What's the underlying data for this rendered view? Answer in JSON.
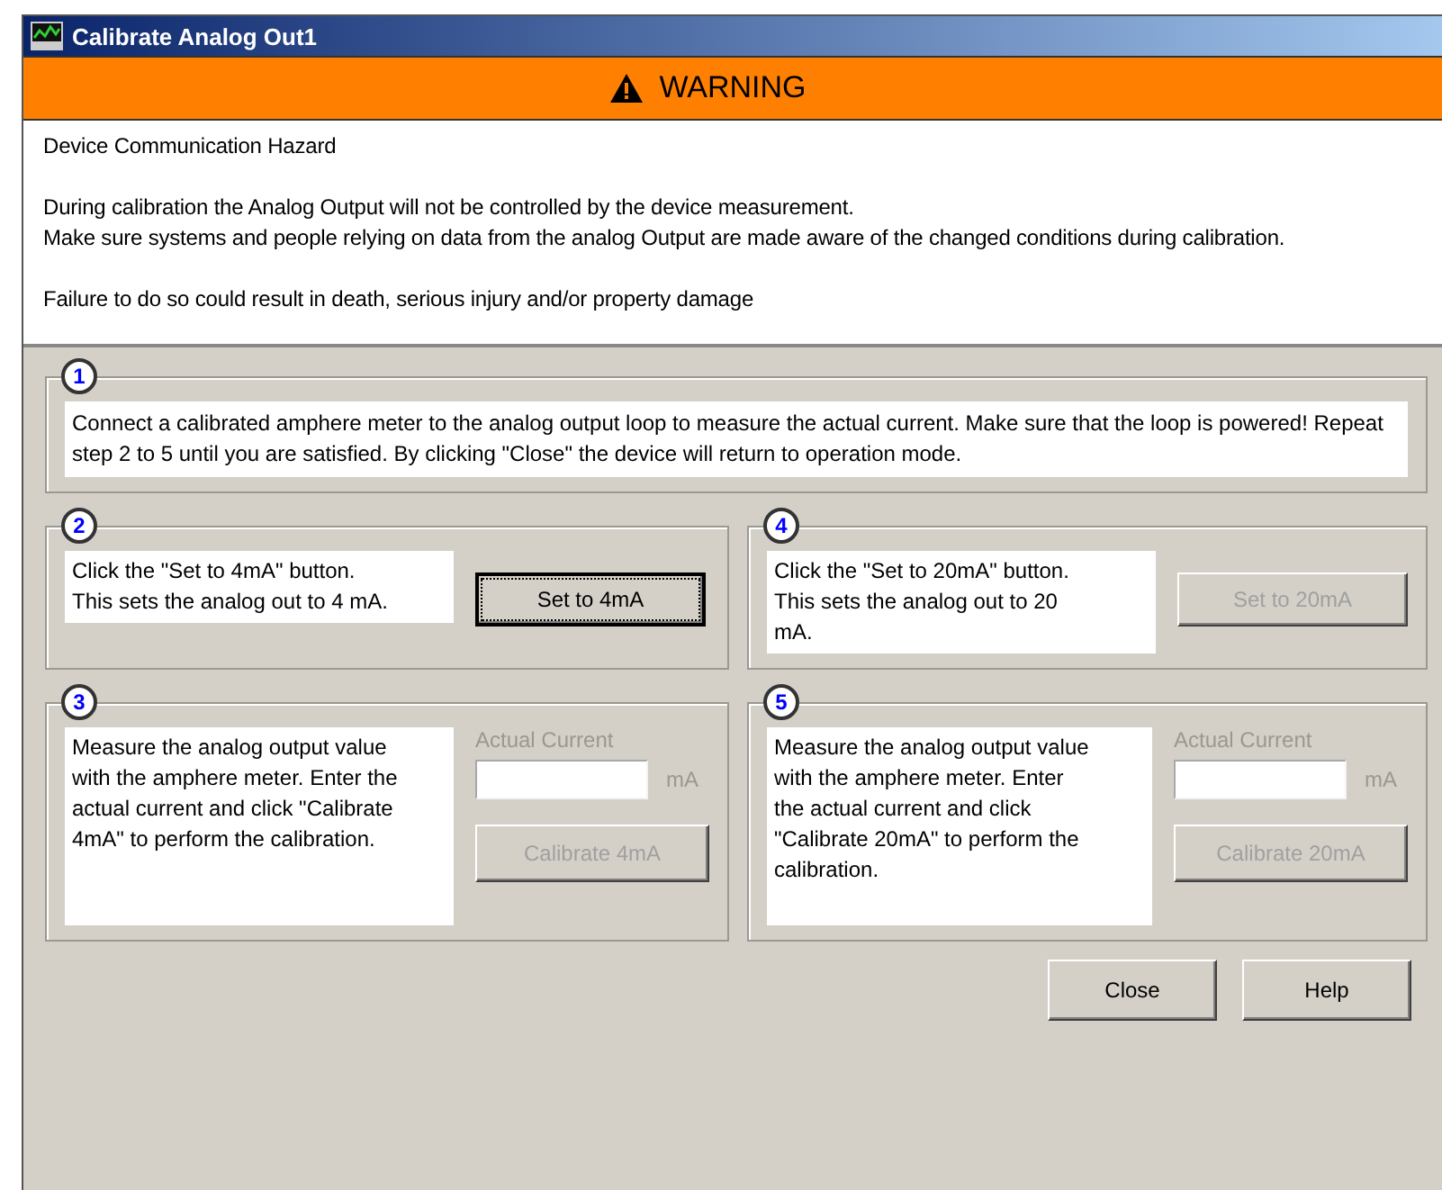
{
  "window": {
    "title": "Calibrate Analog Out1"
  },
  "warning": {
    "heading": "WARNING",
    "paragraphs": [
      "Device Communication Hazard",
      "During calibration the Analog Output will not be controlled by the device measurement.\nMake sure systems and people relying on data from the analog Output are made aware of the changed conditions during calibration.",
      "Failure to do so could result in death, serious injury and/or property damage"
    ]
  },
  "steps": [
    {
      "number": "1",
      "kind": "info",
      "text": "Connect a calibrated amphere meter to the analog output loop to measure the actual current. Make sure that the loop is powered! Repeat step 2 to 5 until you are satisfied. By clicking \"Close\" the device will return to operation mode."
    },
    {
      "number": "2",
      "kind": "set",
      "text": "Click the \"Set to 4mA\" button. This sets the analog out to 4 mA.",
      "button": {
        "label": "Set to 4mA",
        "disabled": false,
        "focused": true
      }
    },
    {
      "number": "4",
      "kind": "set",
      "text": "Click the \"Set to 20mA\" button. This sets the analog out to 20 mA.",
      "button": {
        "label": "Set to 20mA",
        "disabled": true,
        "focused": false
      }
    },
    {
      "number": "3",
      "kind": "calibrate",
      "text": "Measure the analog output value with the amphere meter. Enter the actual current and click \"Calibrate 4mA\" to perform the calibration.",
      "field_label": "Actual Current",
      "unit": "mA",
      "disabled": true,
      "button": {
        "label": "Calibrate 4mA",
        "disabled": true,
        "focused": false
      }
    },
    {
      "number": "5",
      "kind": "calibrate",
      "text": "Measure the analog output value with the amphere meter. Enter the actual current and click \"Calibrate 20mA\" to perform the calibration.",
      "field_label": "Actual Current",
      "unit": "mA",
      "disabled": true,
      "button": {
        "label": "Calibrate 20mA",
        "disabled": true,
        "focused": false
      }
    }
  ],
  "buttons": [
    "Close",
    "Help"
  ]
}
